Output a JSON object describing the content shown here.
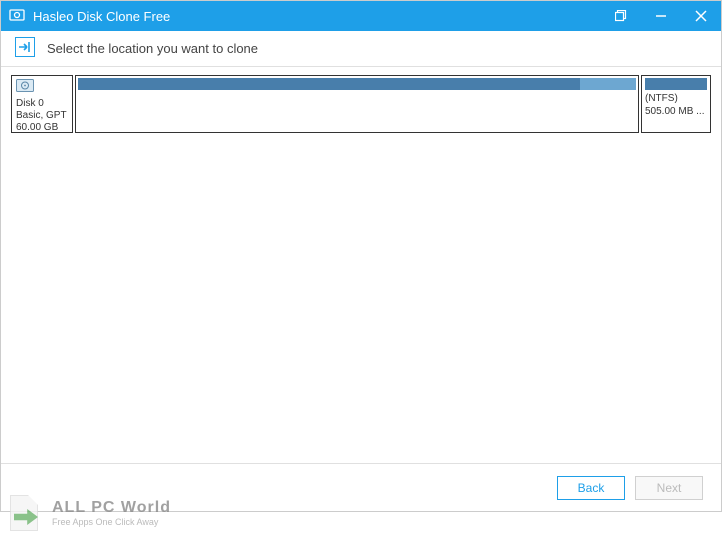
{
  "titlebar": {
    "app_name": "Hasleo Disk Clone Free"
  },
  "subtitle": {
    "text": "Select the location you want to clone"
  },
  "disk": {
    "name": "Disk 0",
    "type_line": "Basic, GPT",
    "size": "60.00 GB",
    "partition_ntfs_label": "(NTFS)",
    "partition_ntfs_size": "505.00 MB ..."
  },
  "buttons": {
    "back": "Back",
    "next": "Next"
  },
  "watermark": {
    "title": "ALL PC World",
    "tagline": "Free Apps One Click Away"
  }
}
